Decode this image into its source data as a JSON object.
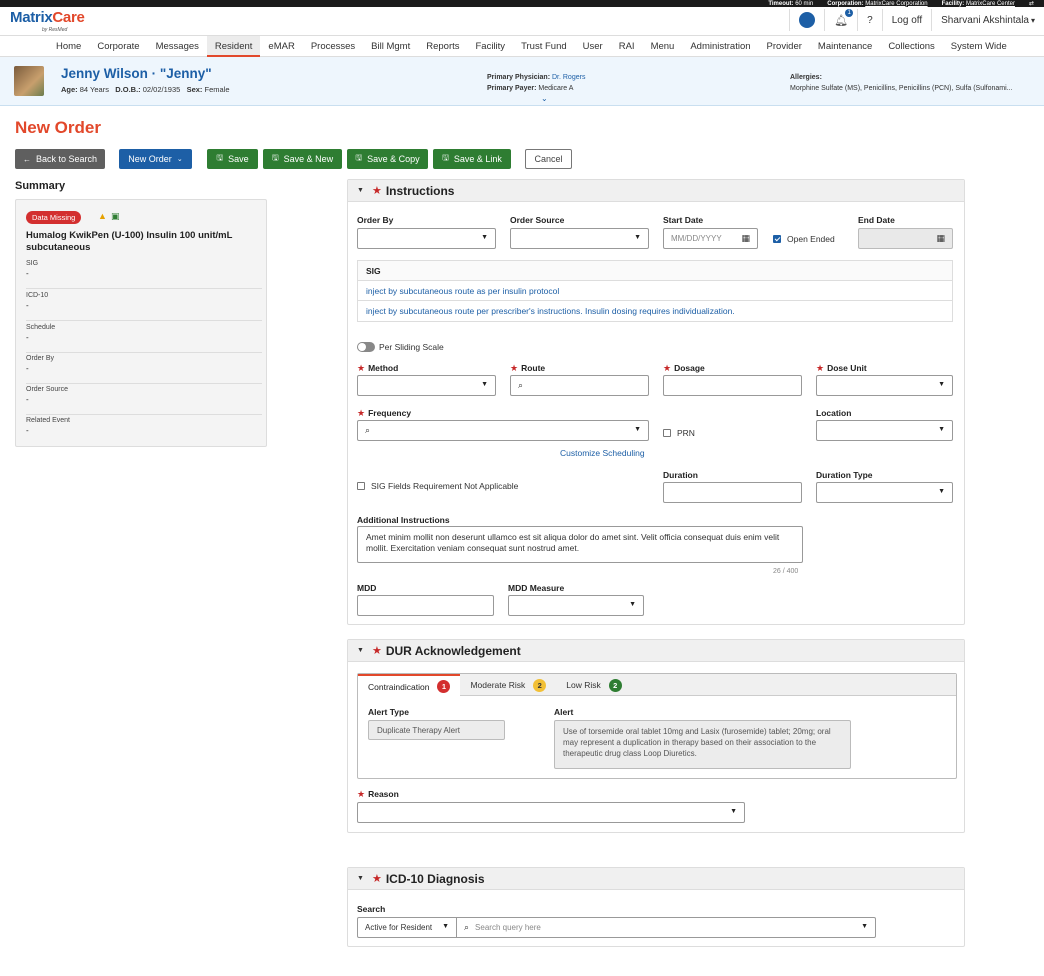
{
  "topbar": {
    "timeout_label": "Timeout:",
    "timeout_value": "60 min",
    "corporation_label": "Corporation:",
    "corporation_value": "MatrixCare Corporation",
    "facility_label": "Facility:",
    "facility_value": "MatrixCare Center"
  },
  "header": {
    "logo_matrix": "Matrix",
    "logo_care": "Care",
    "logo_sub": "by ResMed",
    "notification_count": "1",
    "logoff_label": "Log off",
    "user_name": "Sharvani Akshintala",
    "user_caret": "▾"
  },
  "nav": {
    "items": [
      "Home",
      "Corporate",
      "Messages",
      "Resident",
      "eMAR",
      "Processes",
      "Bill Mgmt",
      "Reports",
      "Facility",
      "Trust Fund",
      "User",
      "RAI",
      "Menu",
      "Administration",
      "Provider",
      "Maintenance",
      "Collections",
      "System Wide"
    ]
  },
  "patient": {
    "name": "Jenny Wilson · \"Jenny\"",
    "age_label": "Age:",
    "age_value": "84 Years",
    "dob_label": "D.O.B.:",
    "dob_value": "02/02/1935",
    "sex_label": "Sex:",
    "sex_value": "Female",
    "physician_label": "Primary Physician:",
    "physician_value": "Dr. Rogers",
    "payer_label": "Primary Payer:",
    "payer_value": "Medicare A",
    "allergies_label": "Allergies:",
    "allergies_value": "Morphine Sulfate (MS), Penicillins, Penicillins (PCN), Sulfa (Sulfonami..."
  },
  "page": {
    "title": "New Order"
  },
  "toolbar": {
    "back": "Back to Search",
    "new_order": "New Order",
    "save": "Save",
    "save_new": "Save & New",
    "save_copy": "Save & Copy",
    "save_link": "Save & Link",
    "cancel": "Cancel"
  },
  "summary": {
    "title": "Summary",
    "badge": "Data Missing",
    "drug": "Humalog KwikPen (U-100) Insulin 100 unit/mL subcutaneous",
    "fields": [
      {
        "label": "SIG",
        "value": "-"
      },
      {
        "label": "ICD-10",
        "value": "-"
      },
      {
        "label": "Schedule",
        "value": "-"
      },
      {
        "label": "Order By",
        "value": "-"
      },
      {
        "label": "Order Source",
        "value": "-"
      },
      {
        "label": "Related Event",
        "value": "-"
      }
    ]
  },
  "instructions": {
    "title": "Instructions",
    "order_by_label": "Order By",
    "order_source_label": "Order Source",
    "start_date_label": "Start Date",
    "start_date_placeholder": "MM/DD/YYYY",
    "open_ended_label": "Open Ended",
    "end_date_label": "End Date",
    "sig_header": "SIG",
    "sig_rows": [
      "inject by subcutaneous route as per insulin protocol",
      "inject by subcutaneous route per prescriber's instructions. Insulin dosing requires individualization."
    ],
    "sliding_scale_label": "Per Sliding Scale",
    "method_label": "Method",
    "route_label": "Route",
    "dosage_label": "Dosage",
    "dose_unit_label": "Dose Unit",
    "frequency_label": "Frequency",
    "prn_label": "PRN",
    "location_label": "Location",
    "customize_label": "Customize Scheduling",
    "sig_na_label": "SIG Fields Requirement Not Applicable",
    "duration_label": "Duration",
    "duration_type_label": "Duration Type",
    "additional_label": "Additional Instructions",
    "additional_value": "Amet minim mollit non deserunt ullamco est sit aliqua dolor do amet sint. Velit officia consequat duis enim velit mollit. Exercitation veniam consequat sunt nostrud amet.",
    "counter": "26 / 400",
    "mdd_label": "MDD",
    "mdd_measure_label": "MDD Measure"
  },
  "dur": {
    "title": "DUR Acknowledgement",
    "tabs": [
      {
        "label": "Contraindication",
        "count": "1"
      },
      {
        "label": "Moderate Risk",
        "count": "2"
      },
      {
        "label": "Low Risk",
        "count": "2"
      }
    ],
    "alert_type_label": "Alert Type",
    "alert_type_value": "Duplicate Therapy Alert",
    "alert_label": "Alert",
    "alert_value": "Use of torsemide oral tablet 10mg and Lasix (furosemide) tablet; 20mg; oral may represent a duplication in therapy based on their association to the therapeutic drug class Loop Diuretics.",
    "reason_label": "Reason"
  },
  "icd": {
    "title": "ICD-10 Diagnosis",
    "search_label": "Search",
    "filter_value": "Active for Resident",
    "search_placeholder": "Search query here"
  }
}
